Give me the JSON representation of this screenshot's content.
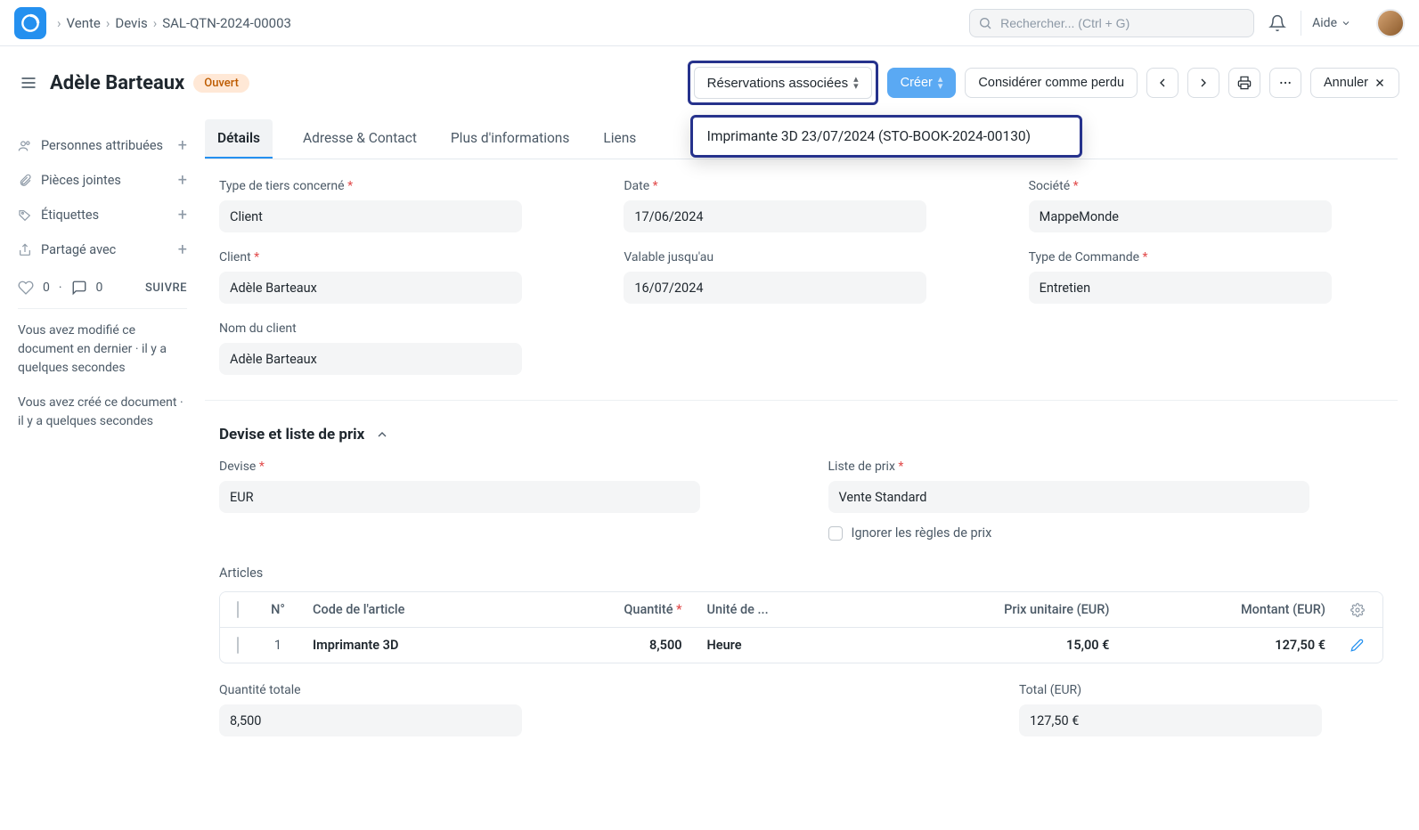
{
  "breadcrumb": [
    "Vente",
    "Devis",
    "SAL-QTN-2024-00003"
  ],
  "search": {
    "placeholder": "Rechercher... (Ctrl + G)"
  },
  "help_label": "Aide",
  "page": {
    "title": "Adèle Barteaux",
    "status": "Ouvert"
  },
  "header_buttons": {
    "reservations": "Réservations associées",
    "create": "Créer",
    "lost": "Considérer comme perdu",
    "cancel": "Annuler"
  },
  "dropdown": {
    "item": "Imprimante 3D 23/07/2024 (STO-BOOK-2024-00130)"
  },
  "sidebar": {
    "rows": [
      "Personnes attribuées",
      "Pièces jointes",
      "Étiquettes",
      "Partagé avec"
    ],
    "likes": "0",
    "comments": "0",
    "follow": "SUIVRE",
    "info1": "Vous avez modifié ce document en dernier · il y a quelques secondes",
    "info2": "Vous avez créé ce document · il y a quelques secondes"
  },
  "tabs": [
    "Détails",
    "Adresse & Contact",
    "Plus d'informations",
    "Liens"
  ],
  "fields": {
    "type_tiers": {
      "label": "Type de tiers concerné",
      "value": "Client"
    },
    "date": {
      "label": "Date",
      "value": "17/06/2024"
    },
    "societe": {
      "label": "Société",
      "value": "MappeMonde"
    },
    "client": {
      "label": "Client",
      "value": "Adèle Barteaux"
    },
    "valable": {
      "label": "Valable jusqu'au",
      "value": "16/07/2024"
    },
    "type_commande": {
      "label": "Type de Commande",
      "value": "Entretien"
    },
    "nom_client": {
      "label": "Nom du client",
      "value": "Adèle Barteaux"
    }
  },
  "section2_title": "Devise et liste de prix",
  "devise": {
    "label": "Devise",
    "value": "EUR"
  },
  "liste_prix": {
    "label": "Liste de prix",
    "value": "Vente Standard"
  },
  "ignore_rules": "Ignorer les règles de prix",
  "articles_label": "Articles",
  "table": {
    "headers": {
      "n": "N°",
      "code": "Code de l'article",
      "qty": "Quantité",
      "uom": "Unité de ...",
      "price": "Prix unitaire (EUR)",
      "amount": "Montant (EUR)"
    },
    "row": {
      "n": "1",
      "code": "Imprimante 3D",
      "qty": "8,500",
      "uom": "Heure",
      "price": "15,00 €",
      "amount": "127,50 €"
    }
  },
  "totals": {
    "qty_label": "Quantité totale",
    "qty_value": "8,500",
    "total_label": "Total (EUR)",
    "total_value": "127,50 €"
  }
}
